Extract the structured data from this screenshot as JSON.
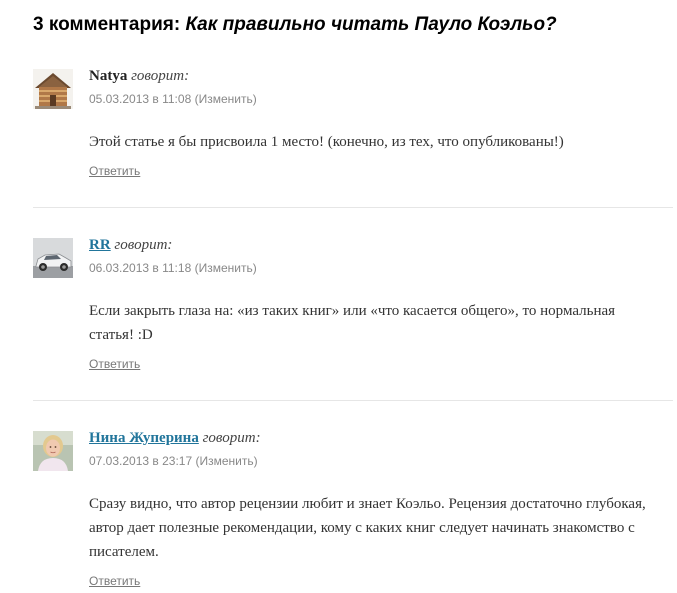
{
  "comments_heading": {
    "count_text": "3 комментария: ",
    "post_title": "Как правильно читать Пауло Коэльо?"
  },
  "comments": [
    {
      "author": "Natya",
      "says": "говорит:",
      "meta": "05.03.2013 в 11:08 (Изменить)",
      "text": "Этой статье я бы присвоила 1 место! (конечно, из тех, что опубликованы!)",
      "reply": "Ответить",
      "avatar_icon": "house-avatar-icon"
    },
    {
      "author": "RR",
      "says": "говорит:",
      "meta": "06.03.2013 в 11:18 (Изменить)",
      "text": "Если закрыть глаза на: «из таких книг» или «что касается общего», то нормальная статья! :D",
      "reply": "Ответить",
      "avatar_icon": "car-avatar-icon"
    },
    {
      "author": "Нина Жуперина",
      "says": "говорит:",
      "meta": "07.03.2013 в 23:17 (Изменить)",
      "text": "Сразу видно, что автор рецензии любит и знает Коэльо. Рецензия достаточно глубокая, автор дает полезные рекомендации, кому с каких книг следует начинать знакомство с писателем.",
      "reply": "Ответить",
      "avatar_icon": "person-avatar-icon"
    }
  ],
  "colors": {
    "link": "#21759b",
    "meta_text": "#888888",
    "divider": "#e6e6e6"
  }
}
